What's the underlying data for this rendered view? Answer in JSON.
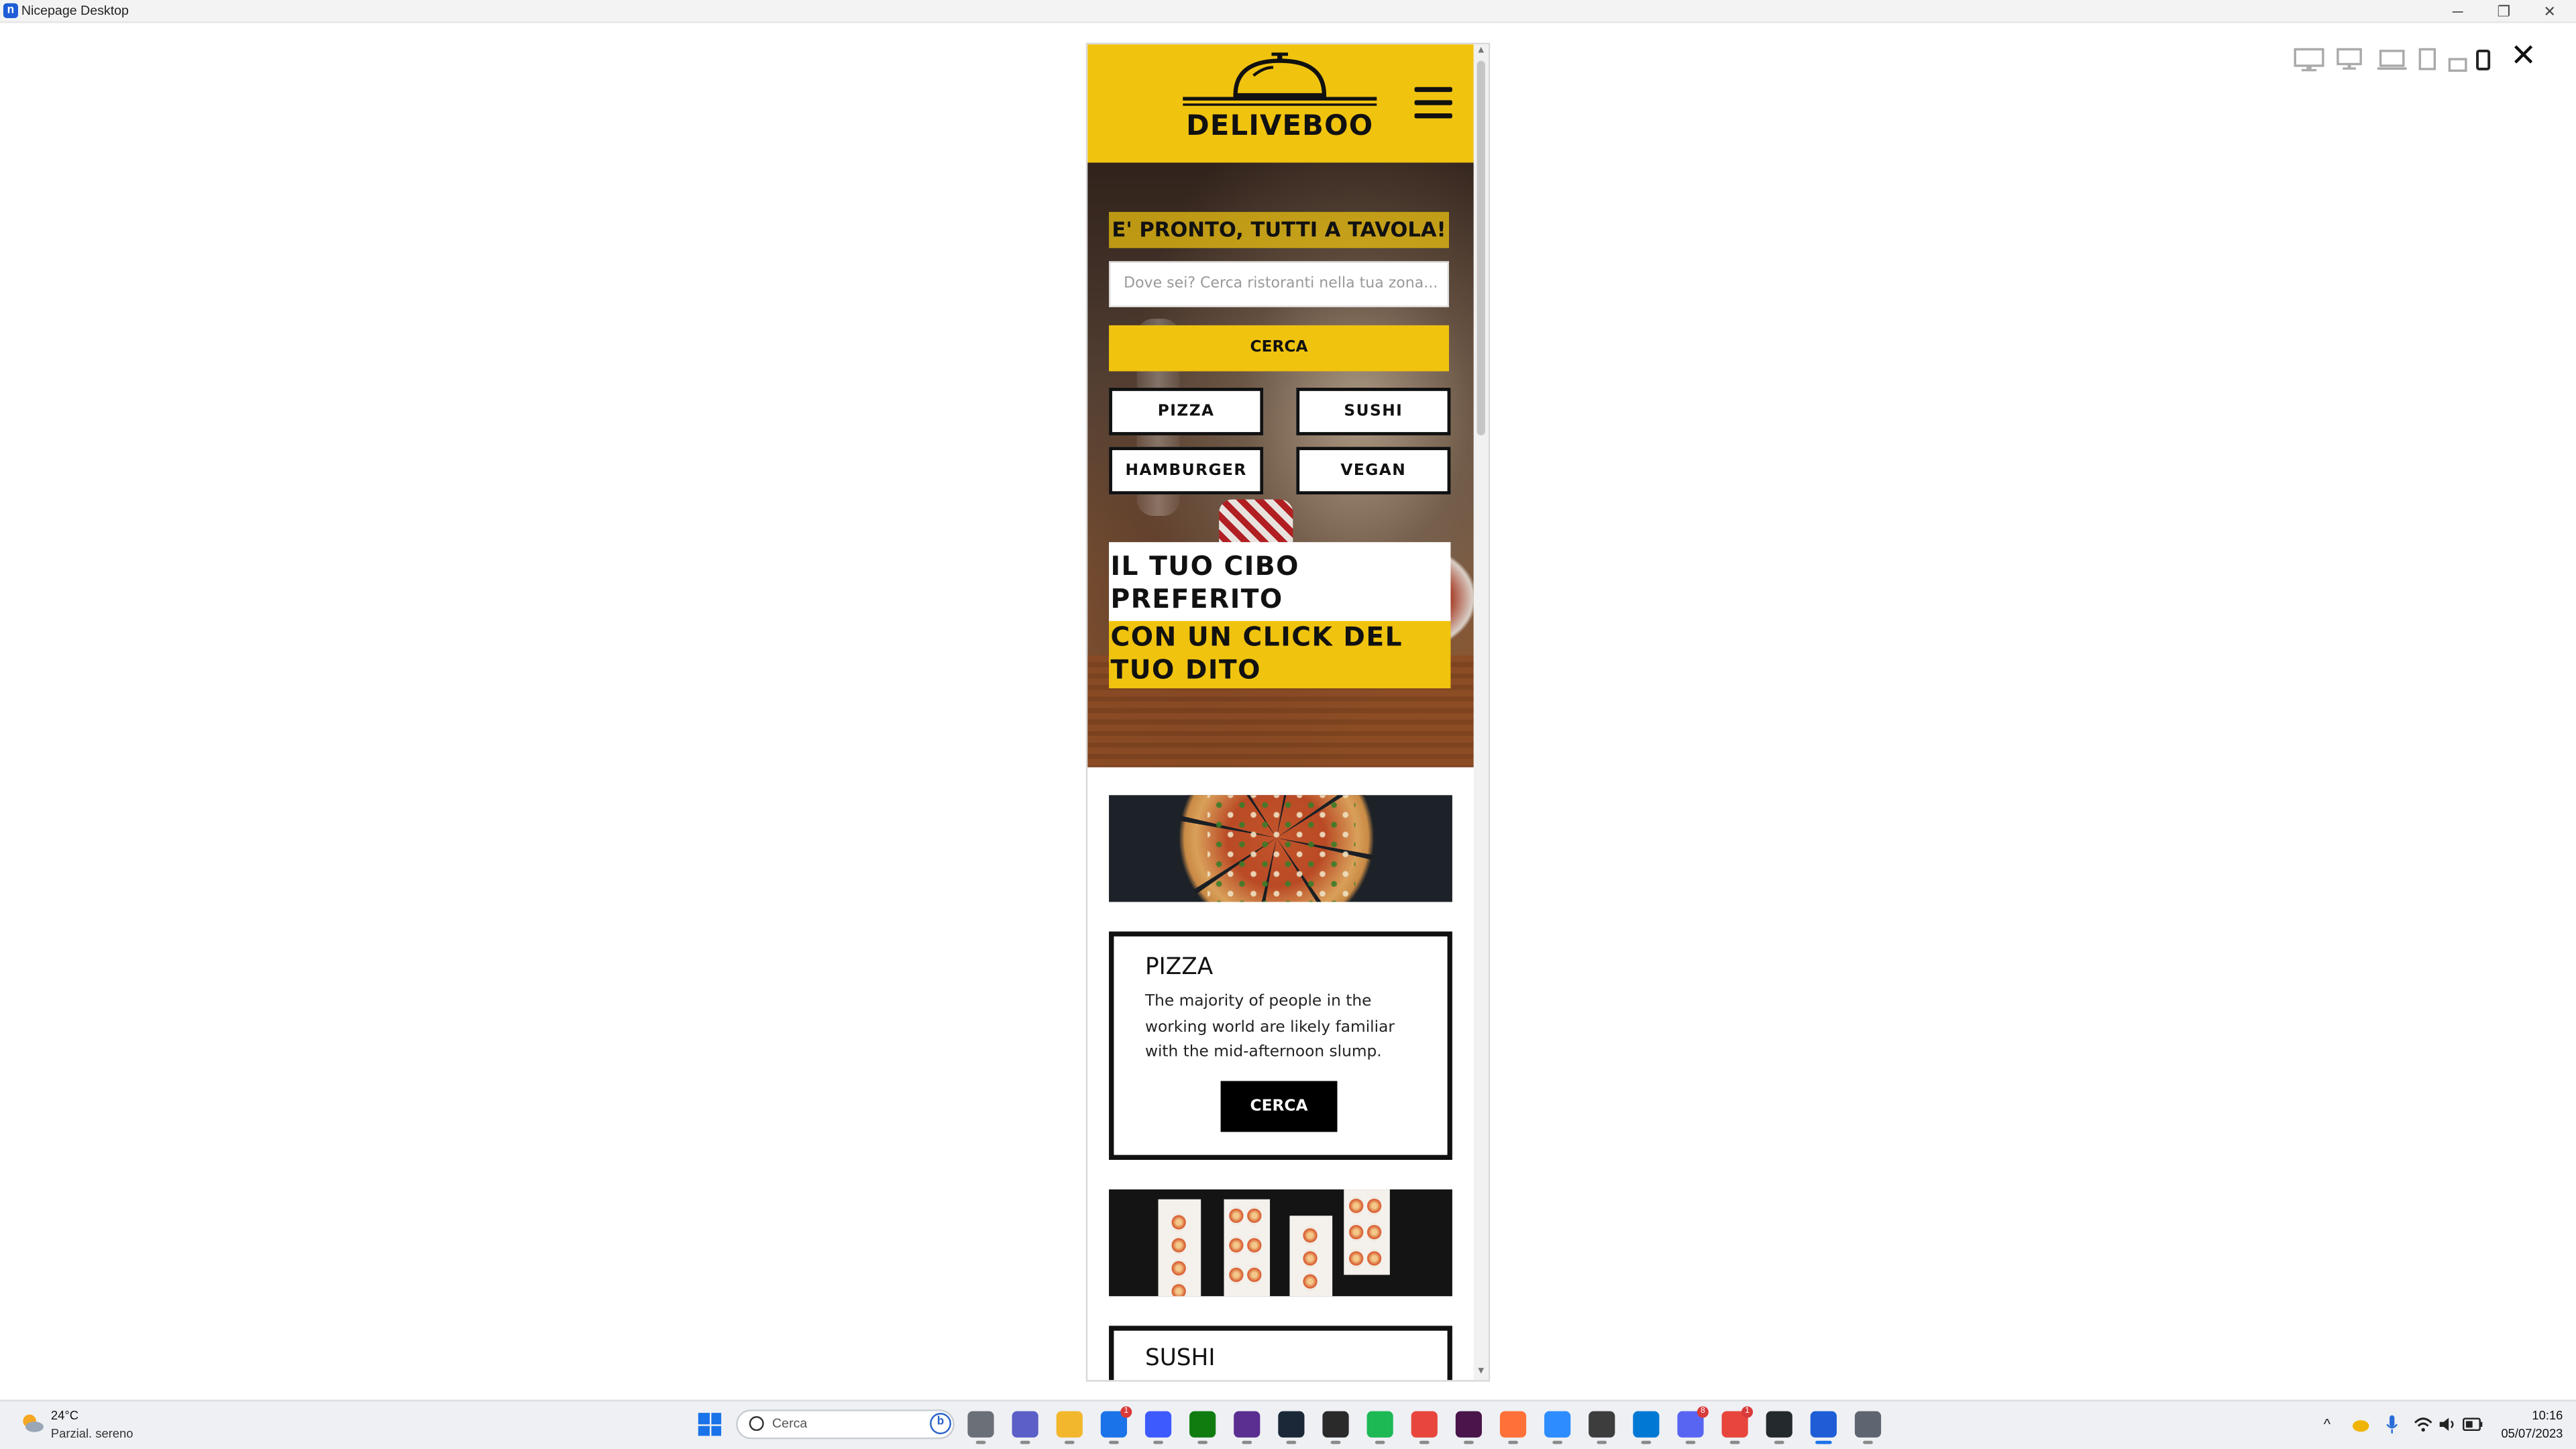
{
  "window": {
    "title": "Nicepage Desktop",
    "app_icon": "n",
    "controls": {
      "minimize": "─",
      "restore": "❐",
      "close": "✕"
    }
  },
  "preview_toolbar": {
    "devices": [
      "desktop-large-icon",
      "desktop-icon",
      "laptop-icon",
      "tablet-icon",
      "tablet-landscape-icon",
      "phone-icon"
    ],
    "selected_device": "phone-icon",
    "close": "✕"
  },
  "site": {
    "brand": "DELIVEBOO",
    "colors": {
      "accent": "#f0c30f",
      "dark": "#111111"
    },
    "hero": {
      "heading": "E' PRONTO, TUTTI A TAVOLA!",
      "search_placeholder": "Dove sei? Cerca ristoranti nella tua zona...",
      "search_button": "CERCA",
      "categories": [
        "PIZZA",
        "SUSHI",
        "HAMBURGER",
        "VEGAN"
      ],
      "tagline_line1": "IL TUO CIBO PREFERITO",
      "tagline_line2": "CON UN CLICK DEL TUO DITO"
    },
    "cards": [
      {
        "title": "PIZZA",
        "text": "The majority of people in the working world are likely familiar with the mid-afternoon slump.",
        "button": "CERCA"
      },
      {
        "title": "SUSHI"
      }
    ]
  },
  "taskbar": {
    "weather": {
      "temp": "24°C",
      "desc": "Parzial. sereno"
    },
    "search_placeholder": "Cerca",
    "apps": [
      {
        "name": "task-view",
        "color": "#6b6f78"
      },
      {
        "name": "teams",
        "color": "#5b5fc7"
      },
      {
        "name": "file-explorer",
        "color": "#f2b72c"
      },
      {
        "name": "mail",
        "color": "#1a73e8",
        "badge": "1"
      },
      {
        "name": "note",
        "color": "#3d5afe"
      },
      {
        "name": "xbox",
        "color": "#107c10"
      },
      {
        "name": "obs",
        "color": "#5b2e91"
      },
      {
        "name": "steam",
        "color": "#1b2838"
      },
      {
        "name": "epic-games",
        "color": "#2a2a2a"
      },
      {
        "name": "spotify",
        "color": "#1db954"
      },
      {
        "name": "chrome",
        "color": "#e8453c"
      },
      {
        "name": "slack",
        "color": "#4a154b"
      },
      {
        "name": "firefox",
        "color": "#ff7139"
      },
      {
        "name": "zoom",
        "color": "#2d8cff"
      },
      {
        "name": "terminal",
        "color": "#3d3d3d"
      },
      {
        "name": "vscode",
        "color": "#0078d4"
      },
      {
        "name": "discord",
        "color": "#5865f2",
        "badge": "8"
      },
      {
        "name": "chrome-2",
        "color": "#e8453c",
        "badge": "1"
      },
      {
        "name": "github",
        "color": "#24292e"
      },
      {
        "name": "nicepage",
        "color": "#1e5dd6",
        "active": true
      },
      {
        "name": "settings",
        "color": "#5e6470"
      }
    ],
    "tray": {
      "chevron": "^",
      "time": "10:16",
      "date": "05/07/2023"
    }
  }
}
